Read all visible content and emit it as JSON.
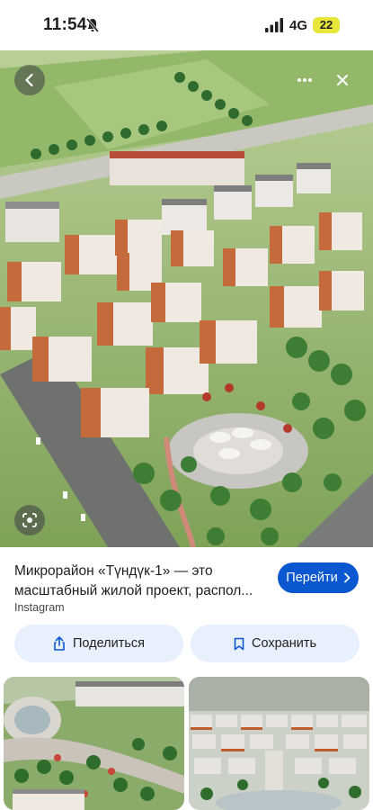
{
  "status_bar": {
    "time": "11:54",
    "network": "4G",
    "battery": "22",
    "icons": [
      "mute-icon",
      "signal-icon"
    ]
  },
  "viewer": {
    "icons": [
      "back-arrow-icon",
      "more-icon",
      "close-icon",
      "lens-icon"
    ]
  },
  "result": {
    "title_line1": "Микрорайон «Түндүк-1» — это",
    "title_line2": "масштабный жилой проект, распол...",
    "source": "Instagram",
    "visit_label": "Перейти",
    "visit_icon": "chevron-right-icon"
  },
  "actions": {
    "share_label": "Поделиться",
    "share_icon": "share-icon",
    "save_label": "Сохранить",
    "save_icon": "bookmark-icon"
  },
  "colors": {
    "accent": "#0b57d0",
    "chip_bg": "#e8f0fe",
    "battery": "#e8e63a"
  }
}
